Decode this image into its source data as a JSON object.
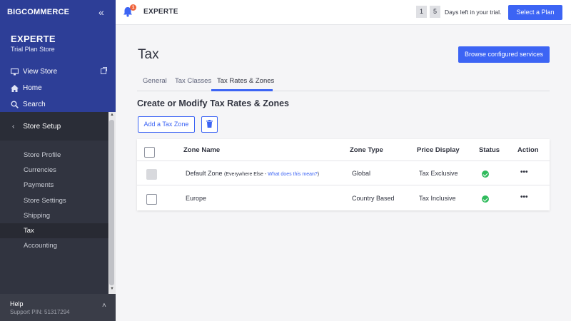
{
  "sidebar": {
    "logo": "BIGCOMMERCE",
    "store_name": "EXPERTE",
    "store_plan": "Trial Plan Store",
    "links": [
      {
        "label": "View Store",
        "icon": "monitor-icon"
      },
      {
        "label": "Home",
        "icon": "home-icon"
      },
      {
        "label": "Search",
        "icon": "search-icon"
      }
    ],
    "section": "Store Setup",
    "items": [
      {
        "label": "Store Profile"
      },
      {
        "label": "Currencies"
      },
      {
        "label": "Payments"
      },
      {
        "label": "Store Settings"
      },
      {
        "label": "Shipping"
      },
      {
        "label": "Tax",
        "active": true
      },
      {
        "label": "Accounting"
      }
    ],
    "footer": {
      "help": "Help",
      "pin": "Support PIN: 51317294"
    }
  },
  "header": {
    "notifications_count": "1",
    "store": "EXPERTE",
    "days_left_digits": [
      "1",
      "5"
    ],
    "days_text": "Days left in your trial.",
    "plan_button": "Select a Plan"
  },
  "main": {
    "title": "Tax",
    "browse_button": "Browse configured services",
    "tabs": [
      {
        "label": "General"
      },
      {
        "label": "Tax Classes"
      },
      {
        "label": "Tax Rates & Zones",
        "active": true
      }
    ],
    "section_title": "Create or Modify Tax Rates & Zones",
    "add_zone_button": "Add a Tax Zone",
    "table": {
      "headers": [
        "Zone Name",
        "Zone Type",
        "Price Display",
        "Status",
        "Action"
      ],
      "rows": [
        {
          "name": "Default Zone",
          "note": "(Everywhere Else - ",
          "link": "What does this mean?",
          "note_end": ")",
          "type": "Global",
          "price_display": "Tax Exclusive",
          "status": "enabled",
          "action": "•••"
        },
        {
          "name": "Europe",
          "type": "Country Based",
          "price_display": "Tax Inclusive",
          "status": "enabled",
          "action": "•••"
        }
      ]
    }
  },
  "colors": {
    "primary": "#3c64f4",
    "sidebar_top": "#2d3e97",
    "sidebar": "#313440",
    "status_green": "#2fbb5c",
    "badge": "#f0643c"
  }
}
